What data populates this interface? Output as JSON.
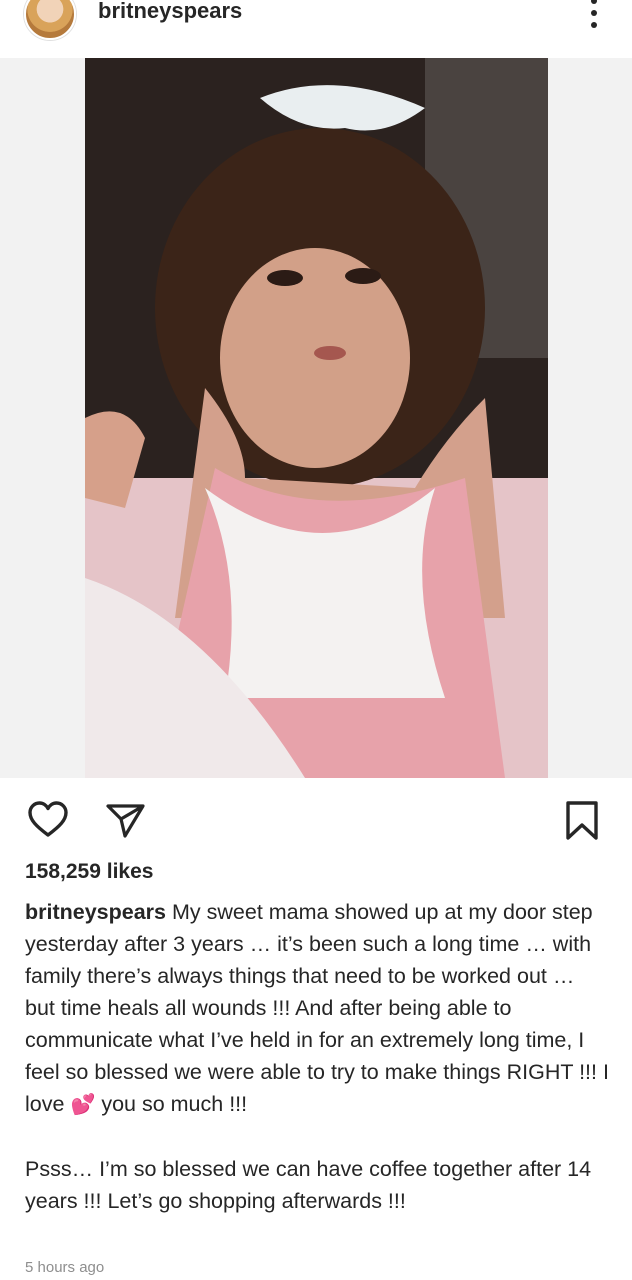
{
  "post": {
    "username": "britneyspears",
    "likes": "158,259 likes",
    "caption_paragraph_1": "My sweet mama showed up at my door step yesterday after 3 years … it’s been such a long time … with family there’s always things that need to be worked out … but time heals all wounds !!! And after being able to communicate what I’ve held in for an extremely long time, I feel so blessed we were able to try to make things RIGHT !!! I love",
    "caption_emoji": "💕",
    "caption_paragraph_1_end": "you so much !!!",
    "caption_paragraph_2": "Psss… I’m so blessed we can have coffee together after 14 years !!! Let’s go shopping afterwards !!!",
    "timestamp": "5 hours ago"
  },
  "icons": {
    "more": "more-vertical-icon",
    "like": "heart-outline-icon",
    "share": "send-icon",
    "save": "bookmark-icon"
  },
  "colors": {
    "text": "#262626",
    "muted": "#8e8e8e",
    "media_background": "#f2f2f2"
  }
}
